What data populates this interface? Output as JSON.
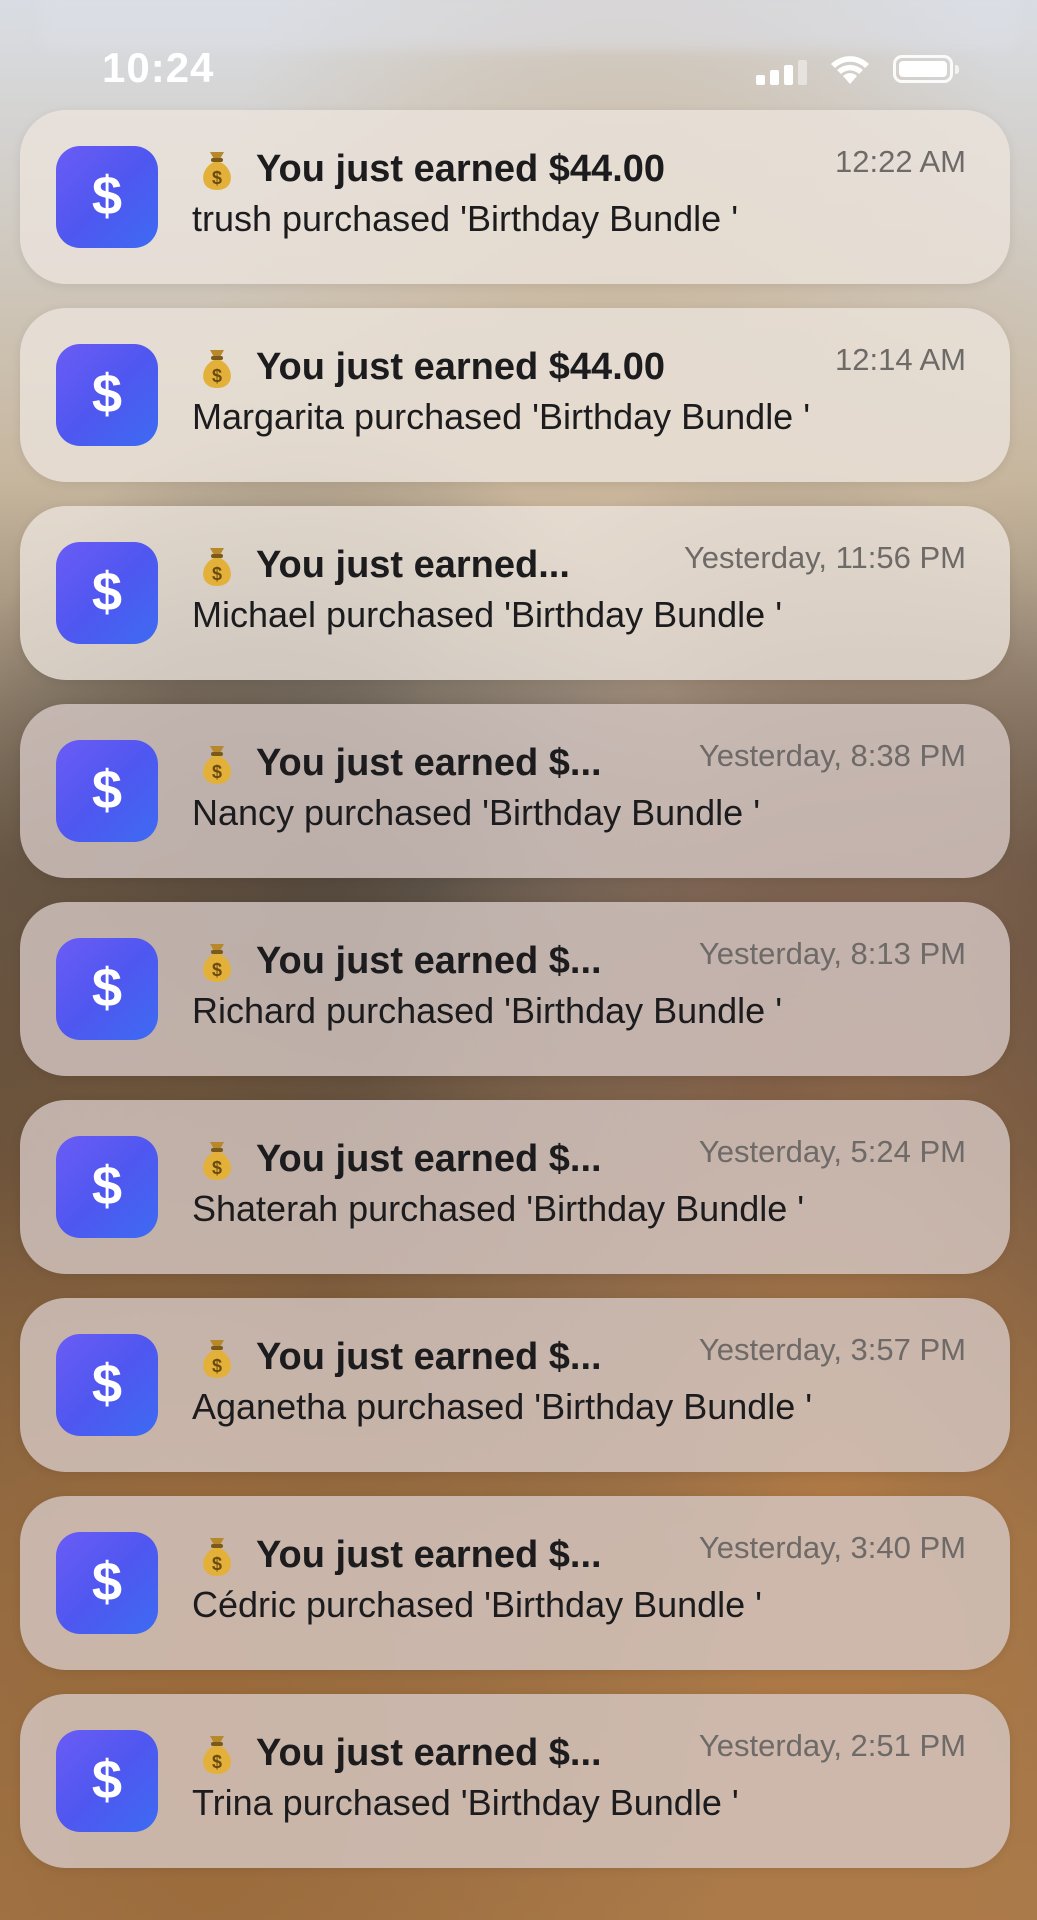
{
  "status_bar": {
    "time": "10:24"
  },
  "notifications": [
    {
      "title": "You just earned $44.00",
      "time": "12:22 AM",
      "body": "trush purchased 'Birthday Bundle '"
    },
    {
      "title": "You just earned $44.00",
      "time": "12:14 AM",
      "body": "Margarita purchased 'Birthday Bundle '"
    },
    {
      "title": "You just earned...",
      "time": "Yesterday, 11:56 PM",
      "body": "Michael purchased 'Birthday Bundle '"
    },
    {
      "title": "You just earned $...",
      "time": "Yesterday, 8:38 PM",
      "body": "Nancy purchased 'Birthday Bundle '"
    },
    {
      "title": "You just earned $...",
      "time": "Yesterday, 8:13 PM",
      "body": "Richard purchased 'Birthday Bundle '"
    },
    {
      "title": "You just earned $...",
      "time": "Yesterday, 5:24 PM",
      "body": "Shaterah purchased 'Birthday Bundle '"
    },
    {
      "title": "You just earned $...",
      "time": "Yesterday, 3:57 PM",
      "body": "Aganetha purchased 'Birthday Bundle '"
    },
    {
      "title": "You just earned $...",
      "time": "Yesterday, 3:40 PM",
      "body": "Cédric purchased 'Birthday Bundle '"
    },
    {
      "title": "You just earned $...",
      "time": "Yesterday, 2:51 PM",
      "body": "Trina purchased 'Birthday Bundle '"
    }
  ],
  "icons": {
    "app_icon": "dollar-sign-icon",
    "title_emoji": "money-bag-icon"
  },
  "colors": {
    "app_icon_gradient_start": "#6b5cf5",
    "app_icon_gradient_end": "#3d6bf2"
  }
}
